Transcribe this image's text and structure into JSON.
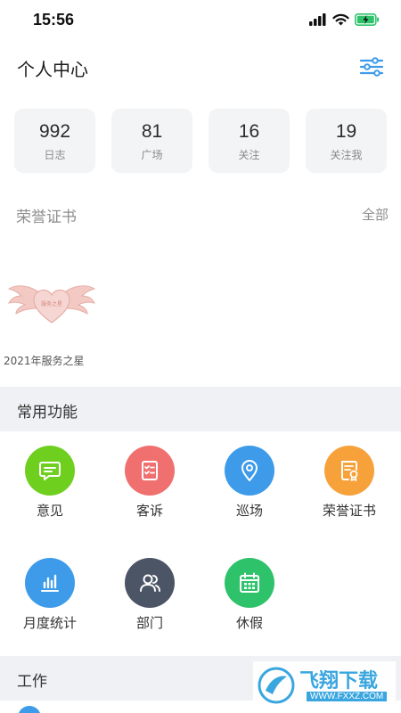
{
  "status_bar": {
    "time": "15:56"
  },
  "header": {
    "title": "个人中心"
  },
  "stats": [
    {
      "value": "992",
      "label": "日志"
    },
    {
      "value": "81",
      "label": "广场"
    },
    {
      "value": "16",
      "label": "关注"
    },
    {
      "value": "19",
      "label": "关注我"
    }
  ],
  "honor": {
    "title": "荣誉证书",
    "all_label": "全部",
    "certificate": {
      "name": "2021年服务之星",
      "badge_text": "服务之星"
    }
  },
  "common_functions": {
    "title": "常用功能",
    "items": [
      {
        "label": "意见",
        "icon": "message-icon",
        "color": "#6fcf1f"
      },
      {
        "label": "客诉",
        "icon": "clipboard-list-icon",
        "color": "#f07070"
      },
      {
        "label": "巡场",
        "icon": "location-pin-icon",
        "color": "#3d9be9"
      },
      {
        "label": "荣誉证书",
        "icon": "certificate-icon",
        "color": "#f7a13a"
      },
      {
        "label": "月度统计",
        "icon": "bar-chart-icon",
        "color": "#3d9be9"
      },
      {
        "label": "部门",
        "icon": "users-icon",
        "color": "#4c5566"
      },
      {
        "label": "休假",
        "icon": "calendar-icon",
        "color": "#2ec26b"
      }
    ]
  },
  "work": {
    "title": "工作"
  },
  "watermark": {
    "text": "飞翔下载",
    "url": "WWW.FXXZ.COM"
  }
}
